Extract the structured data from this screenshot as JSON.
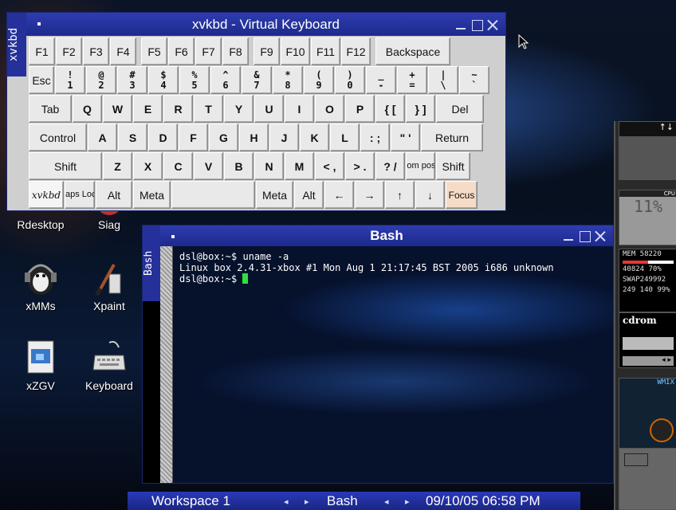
{
  "desktop": {
    "icons": [
      {
        "label": "Rdesktop"
      },
      {
        "label": "Siag"
      },
      {
        "label": "xMMs"
      },
      {
        "label": "Xpaint"
      },
      {
        "label": "xZGV"
      },
      {
        "label": "Keyboard"
      }
    ]
  },
  "xvkbd": {
    "tab_label": "xvkbd",
    "title": "xvkbd - Virtual Keyboard",
    "row1": [
      "F1",
      "F2",
      "F3",
      "F4",
      "F5",
      "F6",
      "F7",
      "F8",
      "F9",
      "F10",
      "F11",
      "F12",
      "Backspace"
    ],
    "row2": [
      {
        "top": "",
        "bottom": "Esc"
      },
      {
        "top": "!",
        "bottom": "1"
      },
      {
        "top": "@",
        "bottom": "2"
      },
      {
        "top": "#",
        "bottom": "3"
      },
      {
        "top": "$",
        "bottom": "4"
      },
      {
        "top": "%",
        "bottom": "5"
      },
      {
        "top": "^",
        "bottom": "6"
      },
      {
        "top": "&",
        "bottom": "7"
      },
      {
        "top": "*",
        "bottom": "8"
      },
      {
        "top": "(",
        "bottom": "9"
      },
      {
        "top": ")",
        "bottom": "0"
      },
      {
        "top": "_",
        "bottom": "-"
      },
      {
        "top": "+",
        "bottom": "="
      },
      {
        "top": "|",
        "bottom": "\\"
      },
      {
        "top": "~",
        "bottom": "`"
      }
    ],
    "row3": [
      "Tab",
      "Q",
      "W",
      "E",
      "R",
      "T",
      "Y",
      "U",
      "I",
      "O",
      "P",
      "{ [",
      "} ]",
      "Del"
    ],
    "row4": [
      "Control",
      "A",
      "S",
      "D",
      "F",
      "G",
      "H",
      "J",
      "K",
      "L",
      ": ;",
      "\" '",
      "Return"
    ],
    "row5": [
      "Shift",
      "Z",
      "X",
      "C",
      "V",
      "B",
      "N",
      "M",
      "< ,",
      "> .",
      "? /",
      "Com pose",
      "Shift"
    ],
    "row6": {
      "logo": "xvkbd",
      "caps": "Caps Lock",
      "alt_left": "Alt",
      "meta_left": "Meta",
      "meta_right": "Meta",
      "alt_right": "Alt",
      "left": "←",
      "right": "→",
      "up": "↑",
      "down": "↓",
      "focus": "Focus"
    }
  },
  "bash": {
    "tab_label": "Bash",
    "title": "Bash",
    "lines": [
      "dsl@box:~$ uname -a",
      "Linux box 2.4.31-xbox #1 Mon Aug 1 21:17:45 BST 2005 i686 unknown",
      "dsl@box:~$ "
    ]
  },
  "dock": {
    "cpu_label": "CPU",
    "cpu_readout": "11%",
    "mem_lines": [
      "MEM  58220",
      "40824  70%",
      "SWAP249992",
      "249 140 99%"
    ],
    "cdrom_label": "cdrom",
    "mixer_label": "WMIX"
  },
  "taskbar": {
    "workspace": "Workspace 1",
    "task": "Bash",
    "datetime": "09/10/05 06:58 PM",
    "arrow_left": "◂",
    "arrow_right": "▸"
  },
  "colors": {
    "title_bar": "#1c2a8c",
    "terminal_cursor": "#2ee23a",
    "focus_key": "#f6dcc7"
  }
}
